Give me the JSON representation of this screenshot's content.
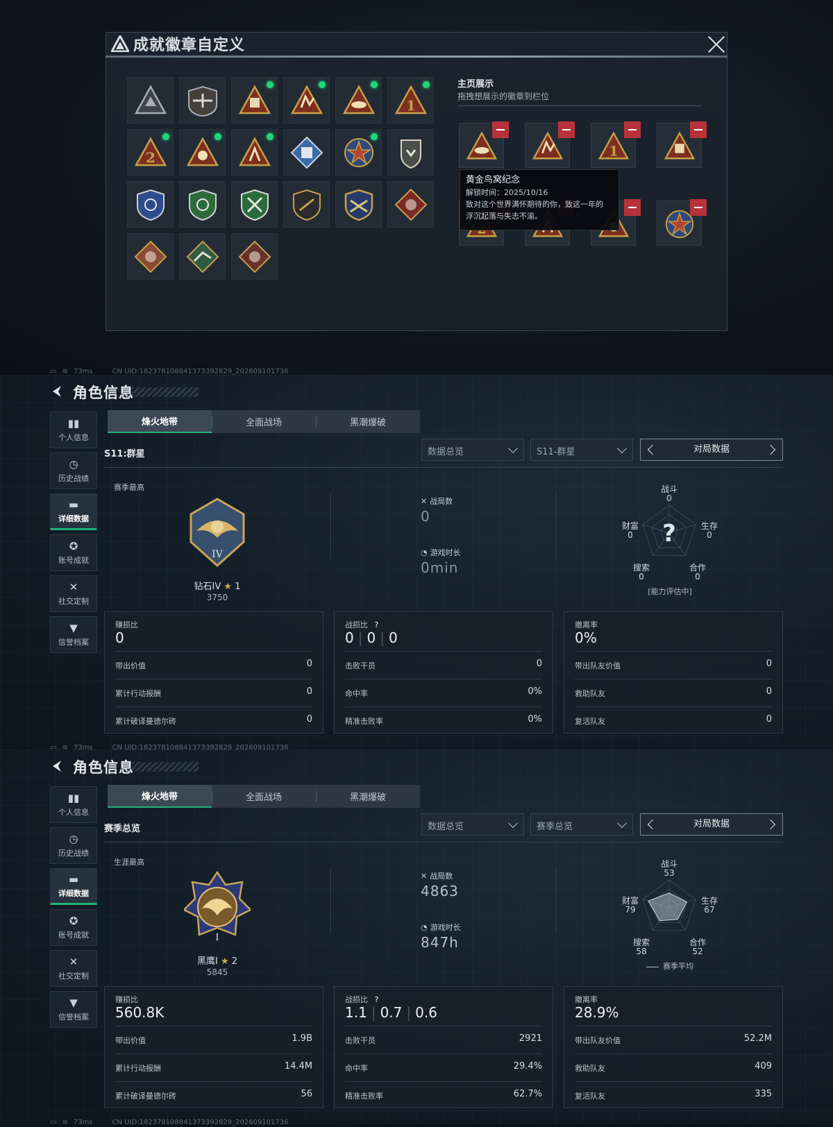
{
  "dialog": {
    "title": "成就徽章自定义",
    "homepage_title": "主页展示",
    "homepage_sub": "拖拽想展示的徽章到栏位",
    "tooltip": {
      "name": "黄金鸟窝纪念",
      "unlock": "解锁时间：2025/10/16",
      "desc1": "致对这个世界满怀期待的你，致这一年的",
      "desc2": "浮沉起落与失志不渝。"
    }
  },
  "status": {
    "ping": "73ms",
    "uid": "CN UID:18237810884137339​2829_202609101736"
  },
  "page": {
    "title": "角色信息",
    "nav": [
      "个人信息",
      "历史战绩",
      "详细数据",
      "账号成就",
      "社交定制",
      "信誉档案"
    ],
    "tabs": [
      "烽火地带",
      "全面战场",
      "黑潮爆破"
    ],
    "data_overview": "数据总览",
    "match_data": "对局数据",
    "lbl_matches": "战局数",
    "lbl_time": "游戏时长",
    "lbl_ratio1": "赚损比",
    "lbl_ratio2": "战损比",
    "lbl_ratio3": "撤离率",
    "rows": {
      "c1": [
        "带出价值",
        "累计行动报酬",
        "累计破译曼德尔砖"
      ],
      "c2": [
        "击败干员",
        "命中率",
        "精准击败率"
      ],
      "c3": [
        "带出队友价值",
        "救助队友",
        "复活队友"
      ]
    },
    "radar_labels": {
      "combat": "战斗",
      "survival": "生存",
      "coop": "合作",
      "search": "搜索",
      "wealth": "财富"
    }
  },
  "season": {
    "sub": "S11:群星",
    "season_dd": "S11-群星",
    "best_label": "赛季最高",
    "rank": "钻石IV",
    "stars": "1",
    "points": "3750",
    "matches": "0",
    "time": "0min",
    "radar": {
      "combat": "0",
      "survival": "0",
      "coop": "0",
      "search": "0",
      "wealth": "0"
    },
    "radar_note": "[能力评估中]",
    "ratio1": "0",
    "ratio2": [
      "0",
      "0",
      "0"
    ],
    "ratio3": "0%",
    "v1": [
      "0",
      "0",
      "0"
    ],
    "v2": [
      "0",
      "0%",
      "0%"
    ],
    "v3": [
      "0",
      "0",
      "0"
    ]
  },
  "career": {
    "sub": "赛季总览",
    "season_dd": "赛季总览",
    "best_label": "生涯最高",
    "rank": "黑鹰I",
    "stars": "2",
    "points": "5845",
    "matches": "4863",
    "time": "847h",
    "radar": {
      "combat": "53",
      "survival": "67",
      "coop": "52",
      "search": "58",
      "wealth": "79"
    },
    "radar_legend": "赛季平均",
    "ratio1": "560.8K",
    "ratio2": [
      "1.1",
      "0.7",
      "0.6"
    ],
    "ratio3": "28.9%",
    "v1": [
      "1.9B",
      "14.4M",
      "56"
    ],
    "v2": [
      "2921",
      "29.4%",
      "62.7%"
    ],
    "v3": [
      "52.2M",
      "409",
      "335"
    ]
  }
}
